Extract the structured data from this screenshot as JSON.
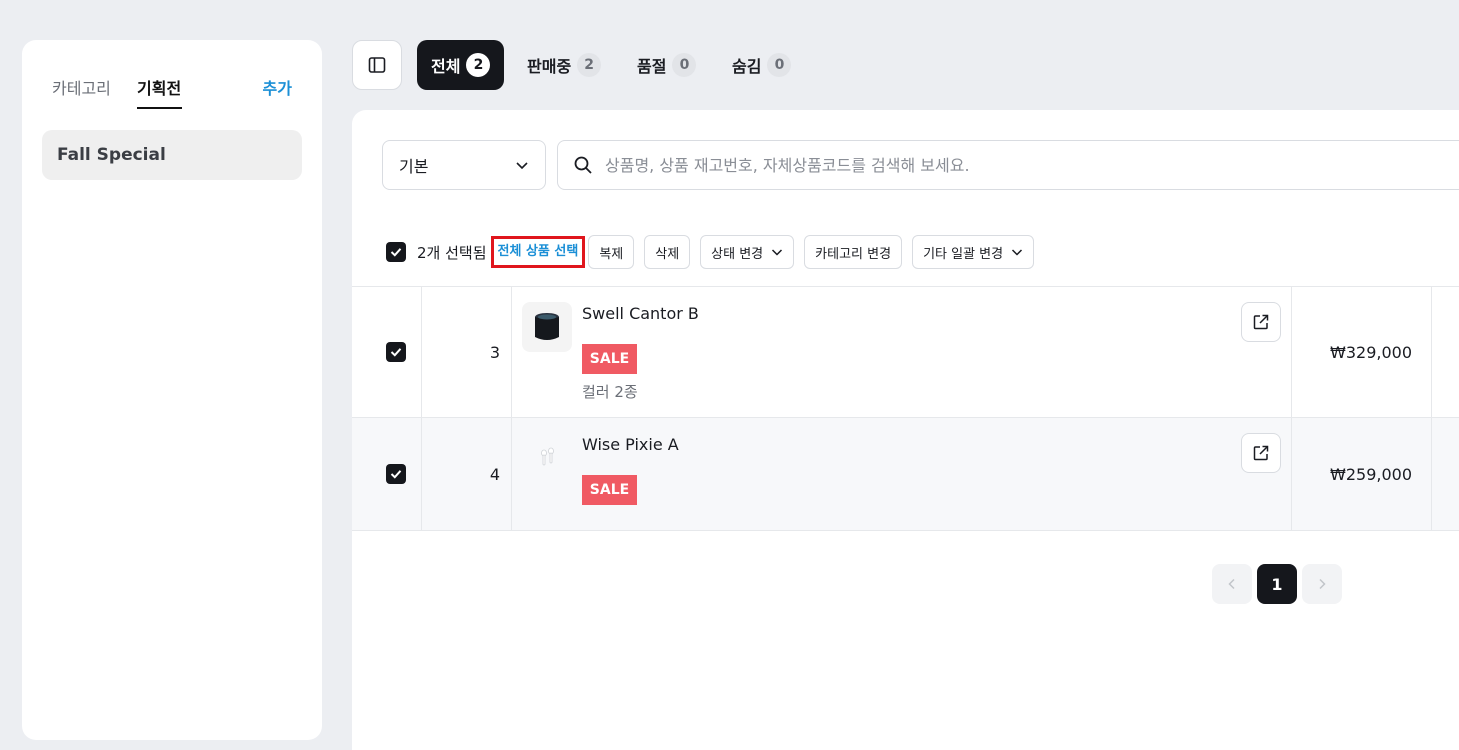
{
  "sidebar": {
    "tabs": [
      "카테고리",
      "기획전"
    ],
    "active_tab": "기획전",
    "add_label": "추가",
    "items": [
      {
        "label": "Fall Special"
      }
    ]
  },
  "top_tabs": [
    {
      "label": "전체",
      "count": "2",
      "active": true
    },
    {
      "label": "판매중",
      "count": "2"
    },
    {
      "label": "품절",
      "count": "0"
    },
    {
      "label": "숨김",
      "count": "0"
    }
  ],
  "filter": {
    "selected": "기본"
  },
  "search": {
    "placeholder": "상품명, 상품 재고번호, 자체상품코드를 검색해 보세요."
  },
  "toolbar": {
    "selected_text": "2개 선택됨",
    "select_all": "전체 상품 선택",
    "buttons": [
      "복제",
      "삭제",
      "상태 변경",
      "카테고리 변경",
      "기타 일괄 변경"
    ]
  },
  "products": [
    {
      "num": "3",
      "name": "Swell Cantor B",
      "badge": "SALE",
      "variant": "컬러 2종",
      "price": "₩329,000"
    },
    {
      "num": "4",
      "name": "Wise Pixie A",
      "badge": "SALE",
      "price": "₩259,000"
    }
  ],
  "pagination": {
    "current": "1"
  }
}
